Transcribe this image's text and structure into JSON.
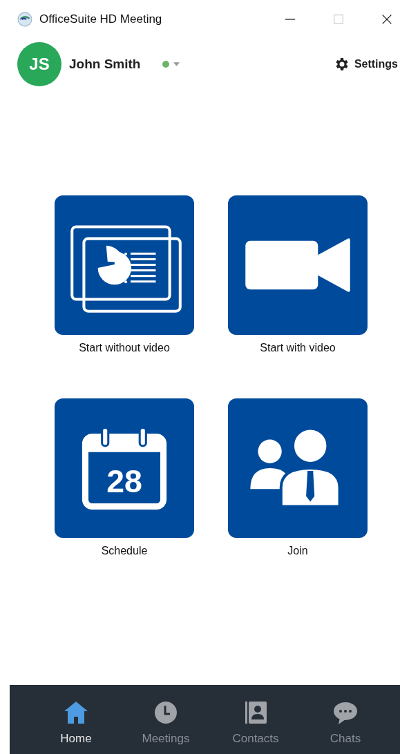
{
  "window": {
    "title": "OfficeSuite HD Meeting"
  },
  "user": {
    "initials": "JS",
    "name": "John Smith",
    "presence": {
      "color": "#6db36d"
    }
  },
  "settings": {
    "label": "Settings"
  },
  "actions": [
    {
      "kind": "share",
      "label": "Start without video"
    },
    {
      "kind": "video",
      "label": "Start with video"
    },
    {
      "kind": "calendar",
      "label": "Schedule",
      "day": "28"
    },
    {
      "kind": "join",
      "label": "Join"
    }
  ],
  "nav": [
    {
      "kind": "home",
      "label": "Home",
      "selected": true
    },
    {
      "kind": "clock",
      "label": "Meetings",
      "selected": false
    },
    {
      "kind": "contacts",
      "label": "Contacts",
      "selected": false
    },
    {
      "kind": "chat",
      "label": "Chats",
      "selected": false
    }
  ]
}
